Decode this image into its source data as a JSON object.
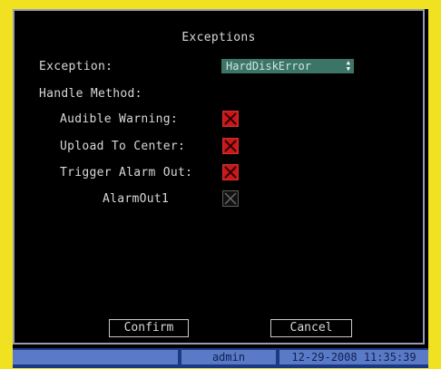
{
  "dialog": {
    "title": "Exceptions",
    "exception_label": "Exception:",
    "exception_value": "HardDiskError",
    "handle_method_label": "Handle Method:",
    "options": [
      {
        "label": "Audible Warning:",
        "checked": true
      },
      {
        "label": "Upload To Center:",
        "checked": true
      },
      {
        "label": "Trigger Alarm Out:",
        "checked": true
      },
      {
        "label": "AlarmOut1",
        "checked": false
      }
    ],
    "confirm_label": "Confirm",
    "cancel_label": "Cancel"
  },
  "status_bar": {
    "user": "admin",
    "datetime": "12-29-2008 11:35:39"
  },
  "colors": {
    "checked": "#c81818",
    "select_bg": "#3c7468",
    "status_bar": "#1c3a84"
  }
}
